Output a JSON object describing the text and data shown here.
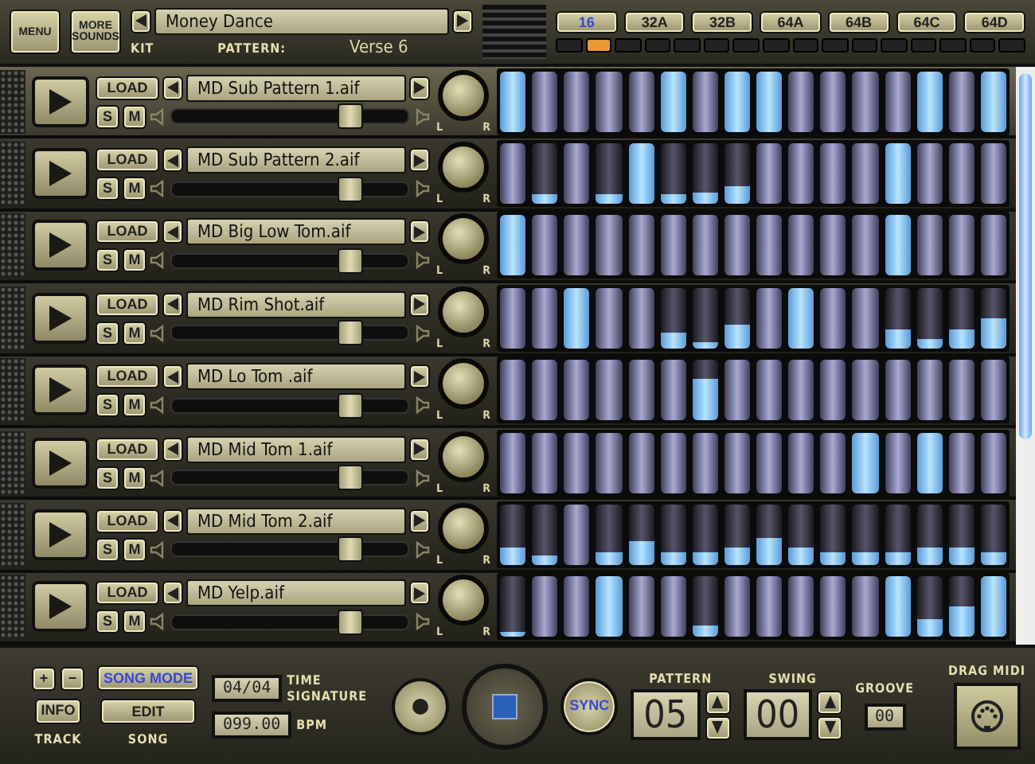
{
  "top_bar": {
    "menu_button": "MENU",
    "more_sounds_button": "MORE SOUNDS",
    "kit": {
      "label": "KIT",
      "name": "Money Dance"
    },
    "pattern": {
      "label": "PATTERN:",
      "name": "Verse 6"
    }
  },
  "pattern_lengths": [
    {
      "label": "16",
      "selected": true
    },
    {
      "label": "32A",
      "selected": false
    },
    {
      "label": "32B",
      "selected": false
    },
    {
      "label": "64A",
      "selected": false
    },
    {
      "label": "64B",
      "selected": false
    },
    {
      "label": "64C",
      "selected": false
    },
    {
      "label": "64D",
      "selected": false
    }
  ],
  "step_leds": [
    {
      "on": false
    },
    {
      "on": true
    },
    {
      "on": false
    },
    {
      "on": false
    },
    {
      "on": false
    },
    {
      "on": false
    },
    {
      "on": false
    },
    {
      "on": false
    },
    {
      "on": false
    },
    {
      "on": false
    },
    {
      "on": false
    },
    {
      "on": false
    },
    {
      "on": false
    },
    {
      "on": false
    },
    {
      "on": false
    },
    {
      "on": false
    }
  ],
  "tracks": [
    {
      "sample": "MD Sub Pattern 1.aif",
      "selected": true,
      "load": "LOAD",
      "solo": "S",
      "mute": "M",
      "volume": {
        "level": 0.75
      },
      "pan_left": "L",
      "pan_right": "R",
      "steps": [
        {
          "level": 1
        },
        {
          "level": 0
        },
        {
          "level": 0
        },
        {
          "level": 0
        },
        {
          "level": 0
        },
        {
          "level": 1
        },
        {
          "level": 0
        },
        {
          "level": 1
        },
        {
          "level": 1
        },
        {
          "level": 0
        },
        {
          "level": 0
        },
        {
          "level": 0
        },
        {
          "level": 0
        },
        {
          "level": 1
        },
        {
          "level": 0
        },
        {
          "level": 1
        }
      ]
    },
    {
      "sample": "MD Sub Pattern 2.aif",
      "selected": false,
      "load": "LOAD",
      "solo": "S",
      "mute": "M",
      "volume": {
        "level": 0.75
      },
      "pan_left": "L",
      "pan_right": "R",
      "steps": [
        {
          "level": 0
        },
        {
          "level": 0.15
        },
        {
          "level": 0
        },
        {
          "level": 0.15
        },
        {
          "level": 1
        },
        {
          "level": 0.15
        },
        {
          "level": 0.18
        },
        {
          "level": 0.3
        },
        {
          "level": 0
        },
        {
          "level": 0
        },
        {
          "level": 0
        },
        {
          "level": 0
        },
        {
          "level": 1
        },
        {
          "level": 0
        },
        {
          "level": 0
        },
        {
          "level": 0
        }
      ]
    },
    {
      "sample": "MD Big Low Tom.aif",
      "selected": false,
      "load": "LOAD",
      "solo": "S",
      "mute": "M",
      "volume": {
        "level": 0.75
      },
      "pan_left": "L",
      "pan_right": "R",
      "steps": [
        {
          "level": 1
        },
        {
          "level": 0
        },
        {
          "level": 0
        },
        {
          "level": 0
        },
        {
          "level": 0
        },
        {
          "level": 0
        },
        {
          "level": 0
        },
        {
          "level": 0
        },
        {
          "level": 0
        },
        {
          "level": 0
        },
        {
          "level": 0
        },
        {
          "level": 0
        },
        {
          "level": 1
        },
        {
          "level": 0
        },
        {
          "level": 0
        },
        {
          "level": 0
        }
      ]
    },
    {
      "sample": "MD Rim Shot.aif",
      "selected": false,
      "load": "LOAD",
      "solo": "S",
      "mute": "M",
      "volume": {
        "level": 0.75
      },
      "pan_left": "L",
      "pan_right": "R",
      "steps": [
        {
          "level": 0
        },
        {
          "level": 0
        },
        {
          "level": 1
        },
        {
          "level": 0
        },
        {
          "level": 0
        },
        {
          "level": 0.25
        },
        {
          "level": 0.1
        },
        {
          "level": 0.4
        },
        {
          "level": 0
        },
        {
          "level": 1
        },
        {
          "level": 0
        },
        {
          "level": 0
        },
        {
          "level": 0.3
        },
        {
          "level": 0.15
        },
        {
          "level": 0.3
        },
        {
          "level": 0.5
        }
      ]
    },
    {
      "sample": "MD Lo Tom .aif",
      "selected": false,
      "load": "LOAD",
      "solo": "S",
      "mute": "M",
      "volume": {
        "level": 0.75
      },
      "pan_left": "L",
      "pan_right": "R",
      "steps": [
        {
          "level": 0
        },
        {
          "level": 0
        },
        {
          "level": 0
        },
        {
          "level": 0
        },
        {
          "level": 0
        },
        {
          "level": 0
        },
        {
          "level": 0.7
        },
        {
          "level": 0
        },
        {
          "level": 0
        },
        {
          "level": 0
        },
        {
          "level": 0
        },
        {
          "level": 0
        },
        {
          "level": 0
        },
        {
          "level": 0
        },
        {
          "level": 0
        },
        {
          "level": 0
        }
      ]
    },
    {
      "sample": "MD Mid Tom 1.aif",
      "selected": false,
      "load": "LOAD",
      "solo": "S",
      "mute": "M",
      "volume": {
        "level": 0.75
      },
      "pan_left": "L",
      "pan_right": "R",
      "steps": [
        {
          "level": 0
        },
        {
          "level": 0
        },
        {
          "level": 0
        },
        {
          "level": 0
        },
        {
          "level": 0
        },
        {
          "level": 0
        },
        {
          "level": 0
        },
        {
          "level": 0
        },
        {
          "level": 0
        },
        {
          "level": 0
        },
        {
          "level": 0
        },
        {
          "level": 1
        },
        {
          "level": 0
        },
        {
          "level": 1
        },
        {
          "level": 0
        },
        {
          "level": 0
        }
      ]
    },
    {
      "sample": "MD Mid Tom 2.aif",
      "selected": false,
      "load": "LOAD",
      "solo": "S",
      "mute": "M",
      "volume": {
        "level": 0.75
      },
      "pan_left": "L",
      "pan_right": "R",
      "steps": [
        {
          "level": 0.3
        },
        {
          "level": 0.15
        },
        {
          "level": 0
        },
        {
          "level": 0.2
        },
        {
          "level": 0.4
        },
        {
          "level": 0.2
        },
        {
          "level": 0.2
        },
        {
          "level": 0.3
        },
        {
          "level": 0.45
        },
        {
          "level": 0.3
        },
        {
          "level": 0.2
        },
        {
          "level": 0.2
        },
        {
          "level": 0.2
        },
        {
          "level": 0.3
        },
        {
          "level": 0.3
        },
        {
          "level": 0.2
        }
      ]
    },
    {
      "sample": "MD Yelp.aif",
      "selected": false,
      "load": "LOAD",
      "solo": "S",
      "mute": "M",
      "volume": {
        "level": 0.75
      },
      "pan_left": "L",
      "pan_right": "R",
      "steps": [
        {
          "level": 0.1
        },
        {
          "level": 0
        },
        {
          "level": 0
        },
        {
          "level": 1
        },
        {
          "level": 0
        },
        {
          "level": 0
        },
        {
          "level": 0.2
        },
        {
          "level": 0
        },
        {
          "level": 0
        },
        {
          "level": 0
        },
        {
          "level": 0
        },
        {
          "level": 0
        },
        {
          "level": 1
        },
        {
          "level": 0.3
        },
        {
          "level": 0.5
        },
        {
          "level": 1
        }
      ]
    }
  ],
  "bottom_bar": {
    "track": {
      "add": "+",
      "remove": "−",
      "info": "INFO",
      "label": "TRACK"
    },
    "song": {
      "mode_button": {
        "label": "SONG MODE",
        "on": true
      },
      "edit": "EDIT",
      "label": "SONG"
    },
    "time_signature": {
      "value": "04/04",
      "label": "TIME SIGNATURE"
    },
    "bpm": {
      "value": "099.00",
      "label": "BPM"
    },
    "sync": {
      "label": "SYNC",
      "on": true
    },
    "pattern": {
      "label": "PATTERN",
      "value": "05"
    },
    "swing": {
      "label": "SWING",
      "value": "00"
    },
    "groove": {
      "label": "GROOVE",
      "value": "00"
    },
    "drag_midi": {
      "label": "DRAG MIDI"
    }
  }
}
